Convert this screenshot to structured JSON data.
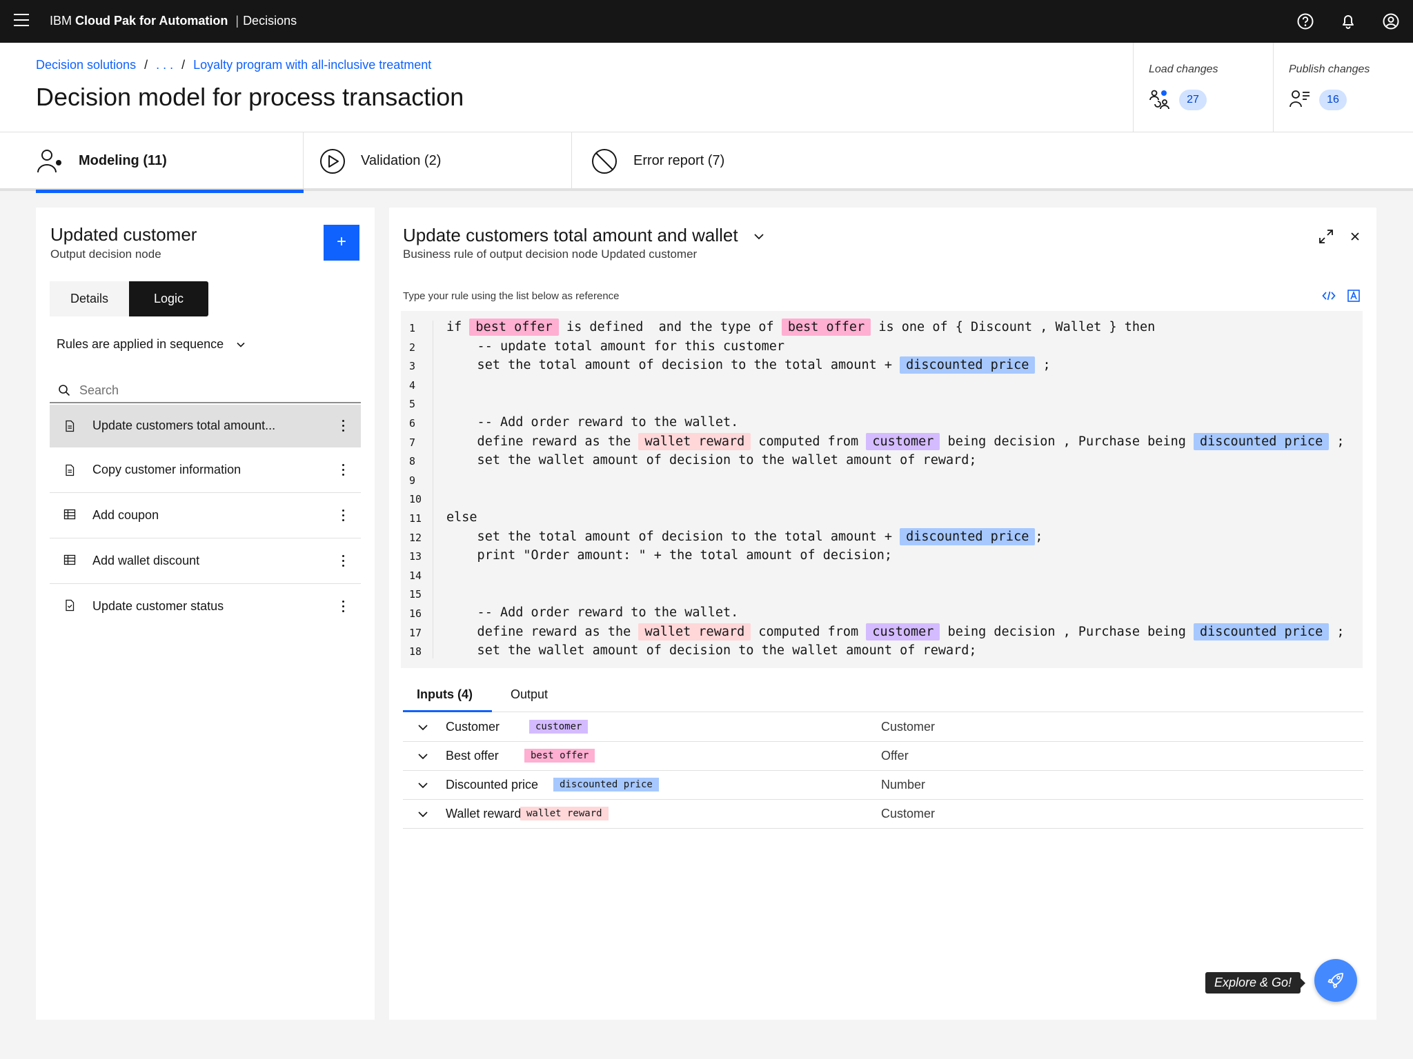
{
  "topbar": {
    "brand_ibm": "IBM",
    "brand_product": "Cloud Pak for Automation",
    "brand_separator": "|",
    "brand_module": "Decisions",
    "icons": [
      "menu-icon",
      "help-icon",
      "notification-icon",
      "user-avatar-icon"
    ]
  },
  "breadcrumb": {
    "items": [
      "Decision solutions",
      ". . .",
      "Loyalty program with all-inclusive treatment"
    ],
    "separator": "/"
  },
  "page": {
    "title": "Decision model for process transaction"
  },
  "changes": {
    "load": {
      "label": "Load changes",
      "count": "27"
    },
    "publish": {
      "label": "Publish changes",
      "count": "16"
    }
  },
  "tabs": [
    {
      "label": "Modeling (11)",
      "icon": "user-modeling-icon",
      "active": true
    },
    {
      "label": "Validation (2)",
      "icon": "play-circle-icon",
      "active": false
    },
    {
      "label": "Error report (7)",
      "icon": "prohibited-icon",
      "active": false
    }
  ],
  "left_panel": {
    "title": "Updated customer",
    "subtitle": "Output decision node",
    "add_label": "+",
    "segments": {
      "details": "Details",
      "logic": "Logic",
      "selected": "Logic"
    },
    "sequence_label": "Rules are applied in sequence",
    "search_placeholder": "Search",
    "rules": [
      {
        "label": "Update customers total amount...",
        "icon": "document-icon",
        "selected": true
      },
      {
        "label": "Copy customer information",
        "icon": "document-icon",
        "selected": false
      },
      {
        "label": "Add coupon",
        "icon": "table-icon",
        "selected": false
      },
      {
        "label": "Add wallet discount",
        "icon": "table-icon",
        "selected": false
      },
      {
        "label": "Update customer status",
        "icon": "document-check-icon",
        "selected": false
      }
    ]
  },
  "right_panel": {
    "title": "Update customers total amount and wallet",
    "subtitle": "Business rule of output decision node Updated customer",
    "hint": "Type your rule using the list below as reference",
    "code_lines": [
      {
        "n": "1",
        "parts": [
          [
            "if ",
            ""
          ],
          [
            "best offer",
            "pink"
          ],
          [
            " is defined  and the type of ",
            ""
          ],
          [
            "best offer",
            "pink"
          ],
          [
            " is one of { Discount , Wallet } then",
            ""
          ]
        ]
      },
      {
        "n": "2",
        "parts": [
          [
            "    -- update total amount for this customer",
            ""
          ]
        ]
      },
      {
        "n": "3",
        "parts": [
          [
            "    set the total amount of decision to the total amount + ",
            ""
          ],
          [
            "discounted price",
            "blue"
          ],
          [
            " ;",
            ""
          ]
        ]
      },
      {
        "n": "4",
        "parts": []
      },
      {
        "n": "5",
        "parts": []
      },
      {
        "n": "6",
        "parts": [
          [
            "    -- Add order reward to the wallet.",
            ""
          ]
        ]
      },
      {
        "n": "7",
        "parts": [
          [
            "    define reward as the ",
            ""
          ],
          [
            "wallet reward",
            "salmon"
          ],
          [
            " computed from ",
            ""
          ],
          [
            "customer",
            "purple"
          ],
          [
            " being decision , Purchase being ",
            ""
          ],
          [
            "discounted price",
            "blue"
          ],
          [
            " ;",
            ""
          ]
        ]
      },
      {
        "n": "8",
        "parts": [
          [
            "    set the wallet amount of decision to the wallet amount of reward;",
            ""
          ]
        ]
      },
      {
        "n": "9",
        "parts": []
      },
      {
        "n": "10",
        "parts": []
      },
      {
        "n": "11",
        "parts": [
          [
            "else",
            ""
          ]
        ]
      },
      {
        "n": "12",
        "parts": [
          [
            "    set the total amount of decision to the total amount + ",
            ""
          ],
          [
            "discounted price",
            "blue"
          ],
          [
            ";",
            ""
          ]
        ]
      },
      {
        "n": "13",
        "parts": [
          [
            "    print \"Order amount: \" + the total amount of decision;",
            ""
          ]
        ]
      },
      {
        "n": "14",
        "parts": []
      },
      {
        "n": "15",
        "parts": []
      },
      {
        "n": "16",
        "parts": [
          [
            "    -- Add order reward to the wallet.",
            ""
          ]
        ]
      },
      {
        "n": "17",
        "parts": [
          [
            "    define reward as the ",
            ""
          ],
          [
            "wallet reward",
            "salmon"
          ],
          [
            " computed from ",
            ""
          ],
          [
            "customer",
            "purple"
          ],
          [
            " being decision , Purchase being ",
            ""
          ],
          [
            "discounted price",
            "blue"
          ],
          [
            " ;",
            ""
          ]
        ]
      },
      {
        "n": "18",
        "parts": [
          [
            "    set the wallet amount of decision to the wallet amount of reward;",
            ""
          ]
        ]
      }
    ],
    "io_tabs": {
      "inputs": "Inputs (4)",
      "output": "Output"
    },
    "inputs": [
      {
        "name": "Customer",
        "tag": "customer",
        "tag_color": "purple",
        "type": "Customer"
      },
      {
        "name": "Best offer",
        "tag": "best offer",
        "tag_color": "pink",
        "type": "Offer"
      },
      {
        "name": "Discounted price",
        "tag": "discounted price",
        "tag_color": "blue",
        "type": "Number"
      },
      {
        "name": "Wallet reward",
        "tag": "wallet reward",
        "tag_color": "salmon",
        "type": "Customer"
      }
    ]
  },
  "explore": {
    "label": "Explore & Go!",
    "icon": "rocket-icon"
  },
  "colors": {
    "accent": "#0f62fe",
    "topbar": "#161616",
    "tag_pink": "#ffafd2",
    "tag_blue": "#a6c8ff",
    "tag_purple": "#d4bbff",
    "tag_salmon": "#ffd7d9"
  }
}
